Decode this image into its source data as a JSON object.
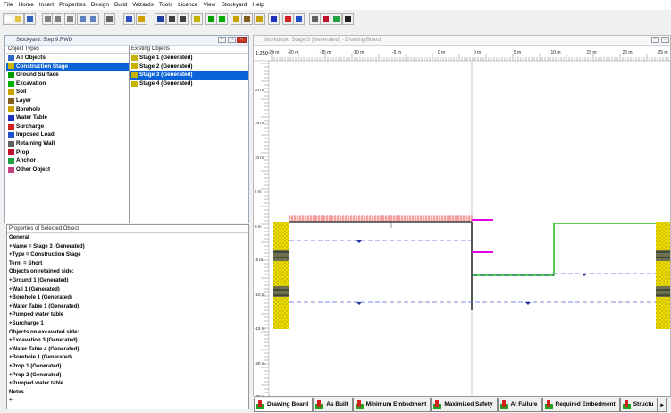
{
  "menu": [
    "File",
    "Home",
    "Insert",
    "Properties",
    "Design",
    "Build",
    "Wizards",
    "Tools",
    "Licence",
    "View",
    "Stockyard",
    "Help"
  ],
  "toolbar_icons": [
    "new-icon",
    "open-icon",
    "save-icon",
    "cut-icon",
    "copy-icon",
    "paste-icon",
    "undo-icon",
    "redo-icon",
    "print-icon",
    "info-icon",
    "help-icon",
    "chart-icon",
    "table-icon",
    "export-icon",
    "stage-icon",
    "ground-icon",
    "excavation-icon",
    "soil-icon",
    "layer-icon",
    "borehole-icon",
    "water-table-icon",
    "surcharge-icon",
    "load-icon",
    "wall-icon",
    "prop-icon",
    "anchor-icon",
    "pointer-icon"
  ],
  "stockyard": {
    "title": "Stockyard: Step 9.RWD",
    "types_header": "Object Types",
    "existing_header": "Existing Objects",
    "types": [
      {
        "label": "All Objects",
        "icon": "all-objects-icon",
        "color": "#3366cc",
        "selected": false
      },
      {
        "label": "Construction Stage",
        "icon": "construction-stage-icon",
        "color": "#c8b400",
        "selected": true
      },
      {
        "label": "Ground Surface",
        "icon": "ground-surface-icon",
        "color": "#00a000",
        "selected": false
      },
      {
        "label": "Excavation",
        "icon": "excavation-icon",
        "color": "#00b000",
        "selected": false
      },
      {
        "label": "Soil",
        "icon": "soil-icon",
        "color": "#c8a000",
        "selected": false
      },
      {
        "label": "Layer",
        "icon": "layer-icon",
        "color": "#806020",
        "selected": false
      },
      {
        "label": "Borehole",
        "icon": "borehole-icon",
        "color": "#c8a000",
        "selected": false
      },
      {
        "label": "Water Table",
        "icon": "water-table-icon",
        "color": "#2030c0",
        "selected": false
      },
      {
        "label": "Surcharge",
        "icon": "surcharge-icon",
        "color": "#d02020",
        "selected": false
      },
      {
        "label": "Imposed Load",
        "icon": "imposed-load-icon",
        "color": "#2050d0",
        "selected": false
      },
      {
        "label": "Retaining Wall",
        "icon": "retaining-wall-icon",
        "color": "#606060",
        "selected": false
      },
      {
        "label": "Prop",
        "icon": "prop-icon",
        "color": "#c01030",
        "selected": false
      },
      {
        "label": "Anchor",
        "icon": "anchor-icon",
        "color": "#20a040",
        "selected": false
      },
      {
        "label": "Other Object",
        "icon": "other-object-icon",
        "color": "#c04080",
        "selected": false
      }
    ],
    "existing": [
      {
        "label": "Stage 1 (Generated)",
        "selected": false
      },
      {
        "label": "Stage 2 (Generated)",
        "selected": false
      },
      {
        "label": "Stage 3 (Generated)",
        "selected": true
      },
      {
        "label": "Stage 4 (Generated)",
        "selected": false
      }
    ],
    "props_header": "Properties of Selected Object",
    "props": [
      "General",
      "+Name = Stage 3 (Generated)",
      "+Type = Construction Stage",
      "Term = Short",
      "Objects on retained side:",
      "+Ground 1 (Generated)",
      "+Wall 1 (Generated)",
      "+Borehole 1 (Generated)",
      "+Water Table 1 (Generated)",
      "+Pumped water table",
      "+Surcharge 1",
      "Objects on excavated side:",
      "+Excavation 3 (Generated)",
      "+Water Table 4 (Generated)",
      "+Borehole 1 (Generated)",
      "+Prop 1 (Generated)",
      "+Prop 2 (Generated)",
      "+Pumped water table",
      "Notes",
      "+-"
    ]
  },
  "drawing": {
    "title": "Workbook: Stage 3 (Generated) - Drawing Board",
    "scale": "1:250",
    "x_labels": [
      "-20 m",
      "-20 m",
      "-15 m",
      "-10 m",
      "-5 m",
      "0 m",
      "0 m",
      "5 m",
      "10 m",
      "15 m",
      "20 m",
      "25 m"
    ],
    "y_labels": [
      "20 m",
      "15 m",
      "10 m",
      "5 m",
      "0 m",
      "-5 m",
      "-10 m",
      "-15 m",
      "-20 m",
      "-25 m"
    ]
  },
  "tabs": [
    {
      "label": "Drawing Board",
      "active": true
    },
    {
      "label": "As Built",
      "active": false
    },
    {
      "label": "Minimum Embedment",
      "active": false
    },
    {
      "label": "Maximized Safety",
      "active": false
    },
    {
      "label": "At Failure",
      "active": false
    },
    {
      "label": "Required Embedment",
      "active": false
    },
    {
      "label": "Structu",
      "active": false
    }
  ]
}
